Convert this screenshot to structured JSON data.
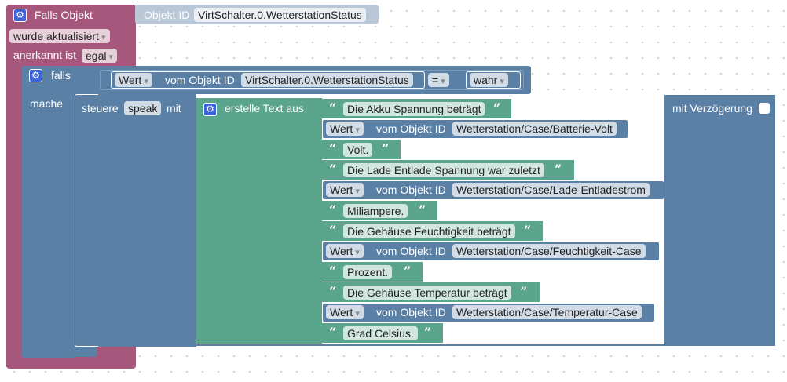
{
  "colors": {
    "event": "#a5577c",
    "logic": "#5b80a5",
    "text": "#5ba58c",
    "gear": "#3f64d8",
    "background": "#ffffff"
  },
  "event_block": {
    "title": "Falls Objekt",
    "object_id_label": "Objekt ID",
    "object_id_value": "VirtSchalter.0.WetterstationStatus",
    "trigger": "wurde aktualisiert",
    "ack_label": "anerkannt ist",
    "ack_value": "egal"
  },
  "if_block": {
    "falls_label": "falls",
    "mache_label": "mache",
    "condition": {
      "value_dropdown": "Wert",
      "of_object_label": "vom Objekt ID",
      "object_id": "VirtSchalter.0.WetterstationStatus",
      "operator": "=",
      "compare_value": "wahr"
    }
  },
  "control_block": {
    "label": "steuere",
    "target": "speak",
    "with_label": "mit",
    "delay_label": "mit Verzögerung"
  },
  "text_join": {
    "label": "erstelle Text aus",
    "items": [
      {
        "type": "text",
        "value": "Die Akku Spannung beträgt"
      },
      {
        "type": "get",
        "dropdown": "Wert",
        "label": "vom Objekt ID",
        "object_id": "Wetterstation/Case/Batterie-Volt"
      },
      {
        "type": "text",
        "value": "Volt."
      },
      {
        "type": "text",
        "value": "Die Lade Entlade Spannung war zuletzt"
      },
      {
        "type": "get",
        "dropdown": "Wert",
        "label": "vom Objekt ID",
        "object_id": "Wetterstation/Case/Lade-Entladestrom"
      },
      {
        "type": "text",
        "value": "Miliampere."
      },
      {
        "type": "text",
        "value": "Die Gehäuse Feuchtigkeit beträgt"
      },
      {
        "type": "get",
        "dropdown": "Wert",
        "label": "vom Objekt ID",
        "object_id": "Wetterstation/Case/Feuchtigkeit-Case"
      },
      {
        "type": "text",
        "value": "Prozent."
      },
      {
        "type": "text",
        "value": "Die Gehäuse Temperatur beträgt"
      },
      {
        "type": "get",
        "dropdown": "Wert",
        "label": "vom Objekt ID",
        "object_id": "Wetterstation/Case/Temperatur-Case"
      },
      {
        "type": "text",
        "value": "Grad Celsius."
      }
    ]
  },
  "glyphs": {
    "open_quote": "“",
    "close_quote": "”",
    "gear": "⚙"
  }
}
